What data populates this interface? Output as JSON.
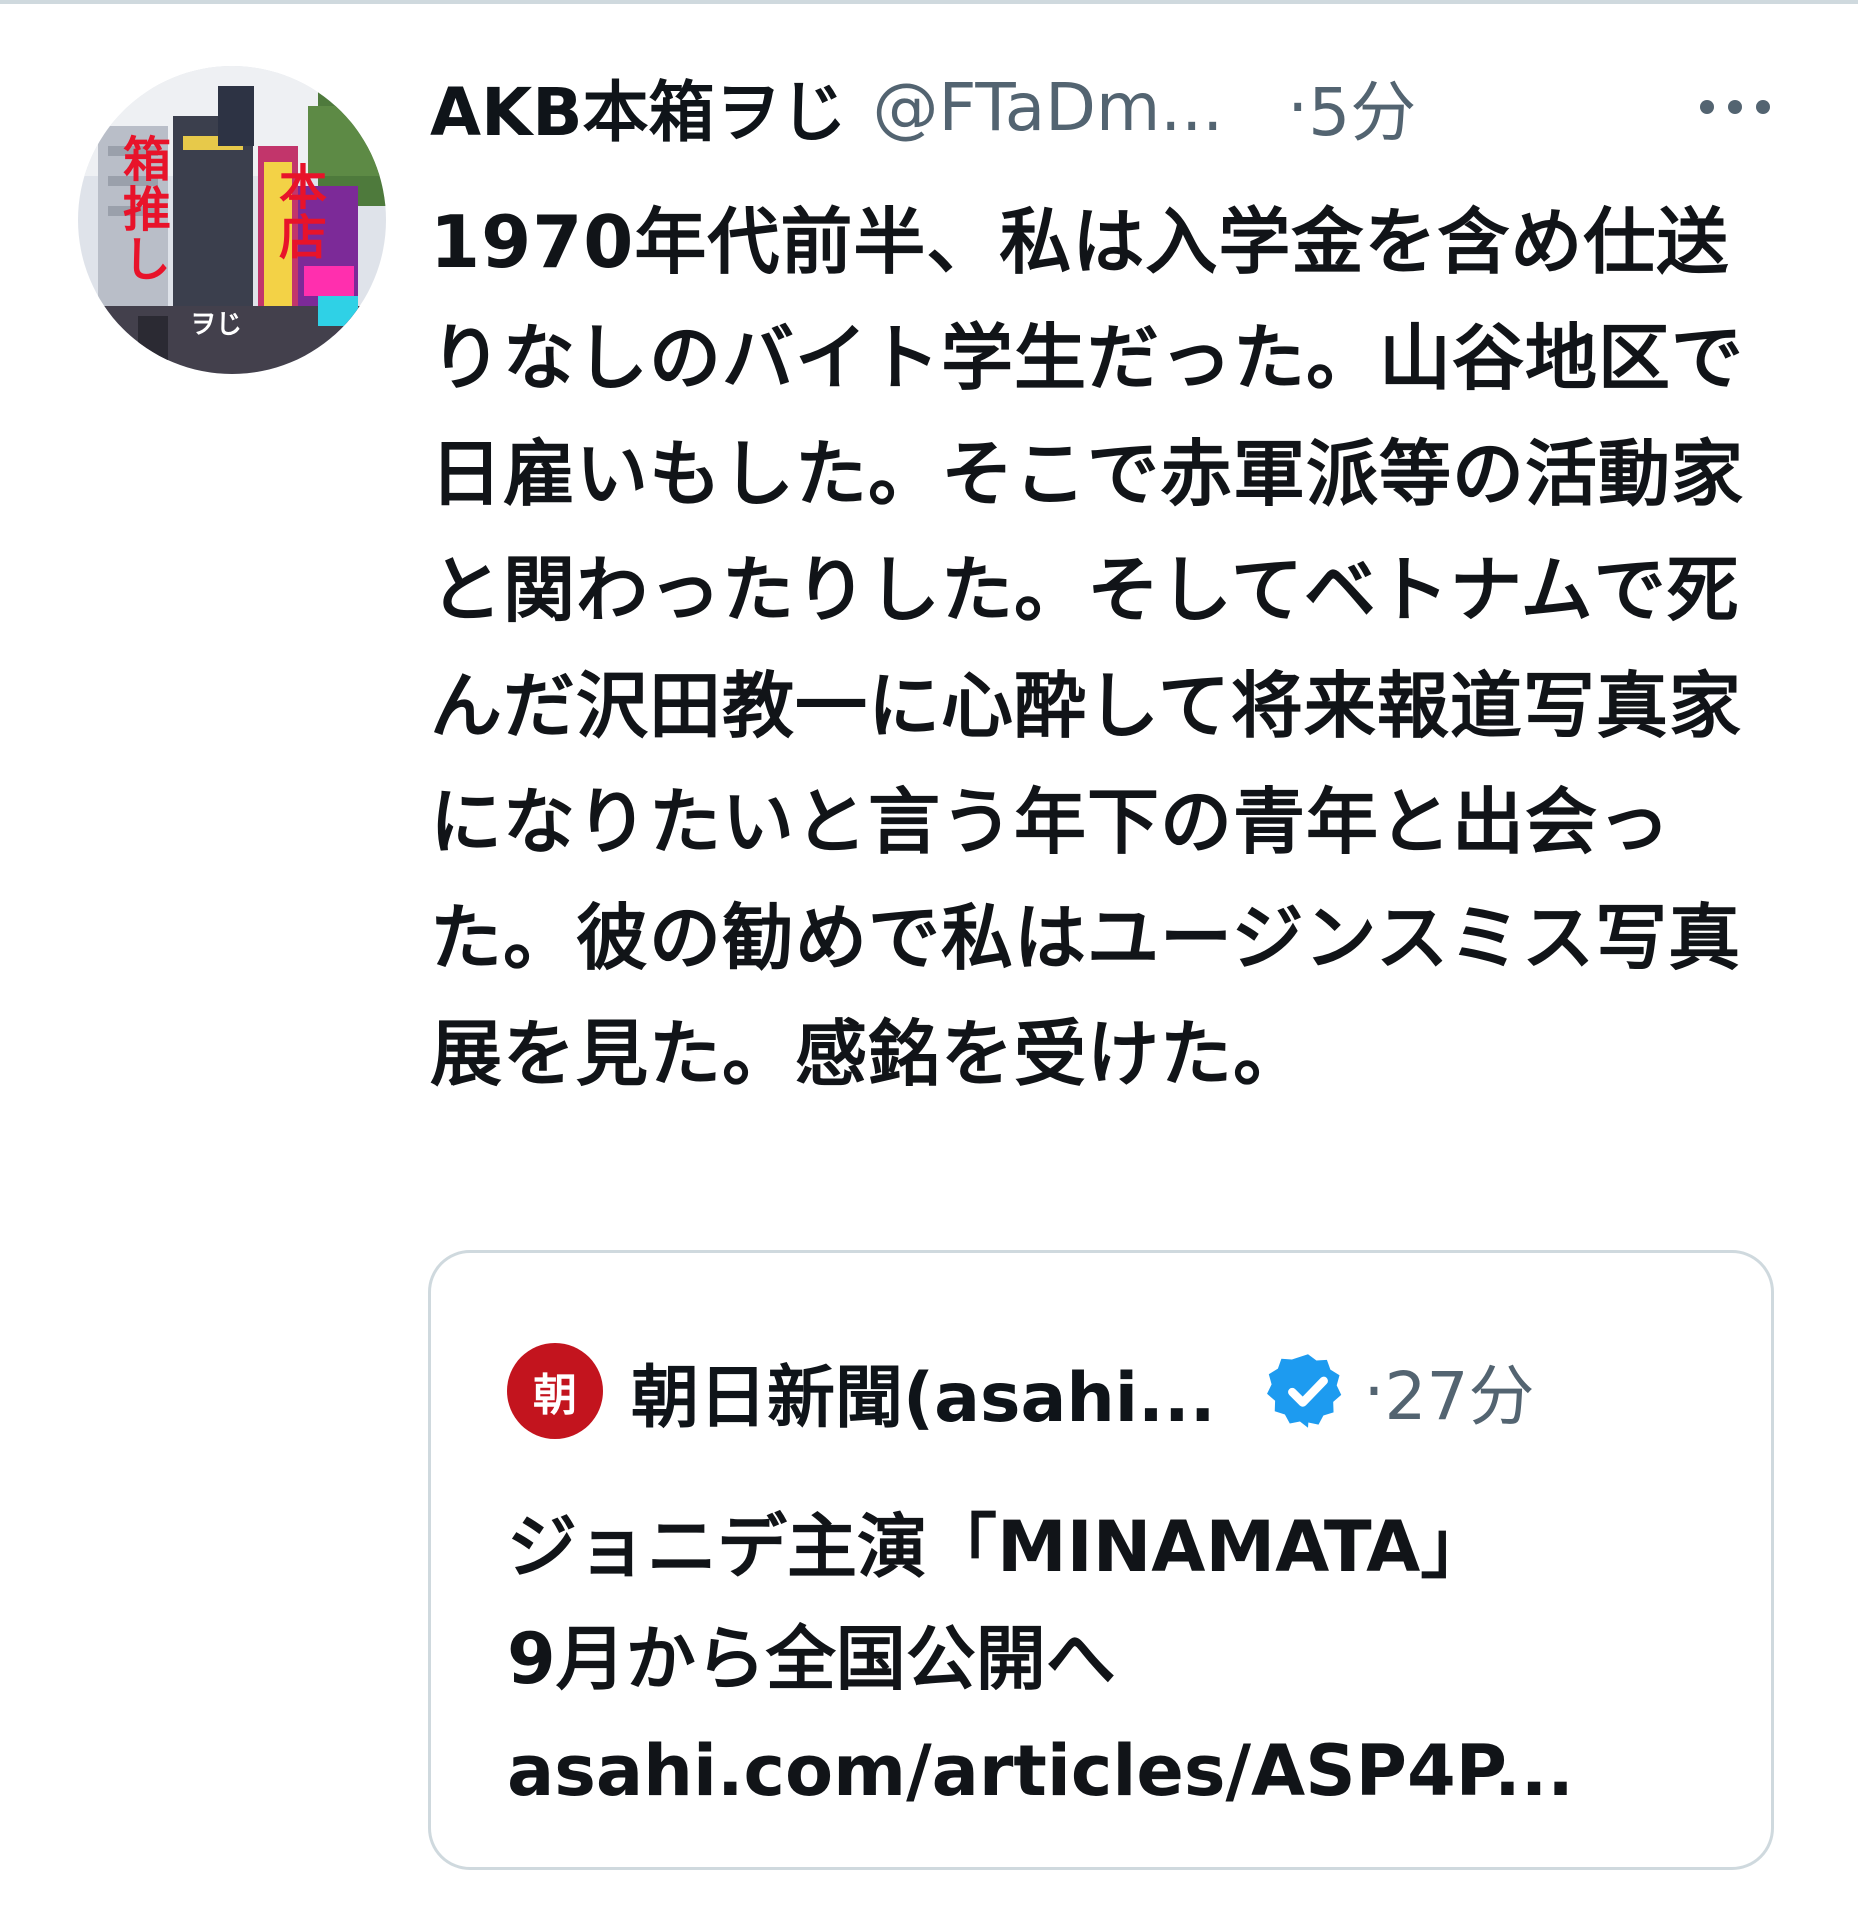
{
  "tweet": {
    "author": {
      "display_name": "AKB本箱ヲじ",
      "handle": "@FTaDm...",
      "avatar_text_left": "箱推し",
      "avatar_text_right": "本店",
      "avatar_text_small": "ヲじ"
    },
    "separator": "·",
    "time": "5分",
    "more_icon": "more-dots-icon",
    "text": "1970年代前半、私は入学金を含め仕送りなしのバイト学生だった。山谷地区で日雇いもした。そこで赤軍派等の活動家と関わったりした。そしてベトナムで死んだ沢田教一に心酔して将来報道写真家になりたいと言う年下の青年と出会った。彼の勧めで私はユージンスミス写真展を見た。感銘を受けた。"
  },
  "quote": {
    "avatar_char": "朝",
    "display_name": "朝日新聞(asahi...",
    "verified_icon": "verified-badge-icon",
    "separator": "·",
    "time": "27分",
    "lines": [
      "ジョニデ主演「MINAMATA」",
      "9月から全国公開へ",
      "asahi.com/articles/ASP4P..."
    ]
  },
  "colors": {
    "text_primary": "#0f1419",
    "text_secondary": "#536471",
    "border": "#cfd9de",
    "verified_blue": "#1d9bf0",
    "asahi_red": "#c3141e"
  }
}
